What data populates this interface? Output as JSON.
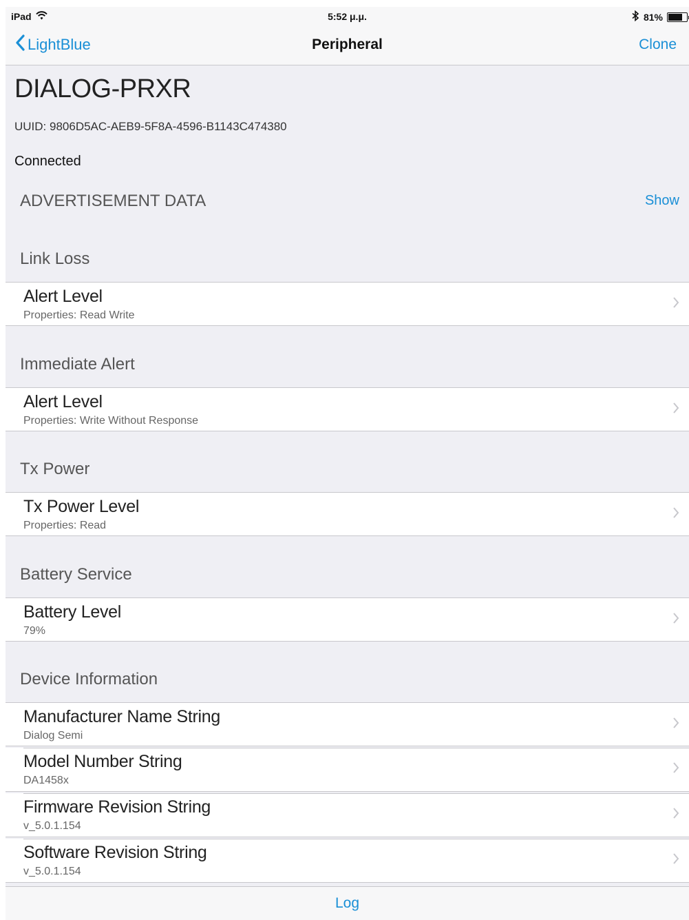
{
  "status_bar": {
    "device": "iPad",
    "time": "5:52 μ.μ.",
    "battery_text": "81%",
    "battery_level": 0.81
  },
  "nav": {
    "back_label": "LightBlue",
    "title": "Peripheral",
    "action_label": "Clone"
  },
  "peripheral": {
    "name": "DIALOG-PRXR",
    "uuid": "UUID: 9806D5AC-AEB9-5F8A-4596-B1143C474380",
    "state": "Connected"
  },
  "advertisement": {
    "title": "ADVERTISEMENT DATA",
    "show_label": "Show"
  },
  "services": [
    {
      "name": "Link Loss",
      "characteristics": [
        {
          "name": "Alert Level",
          "detail": "Properties: Read Write"
        }
      ]
    },
    {
      "name": "Immediate Alert",
      "characteristics": [
        {
          "name": "Alert Level",
          "detail": "Properties: Write Without Response"
        }
      ]
    },
    {
      "name": "Tx Power",
      "characteristics": [
        {
          "name": "Tx Power Level",
          "detail": "Properties: Read"
        }
      ]
    },
    {
      "name": "Battery Service",
      "characteristics": [
        {
          "name": "Battery Level",
          "detail": "79%"
        }
      ]
    },
    {
      "name": "Device Information",
      "characteristics": [
        {
          "name": "Manufacturer Name String",
          "detail": "Dialog Semi"
        },
        {
          "name": "Model Number String",
          "detail": "DA1458x"
        },
        {
          "name": "Firmware Revision String",
          "detail": "v_5.0.1.154"
        },
        {
          "name": "Software Revision String",
          "detail": "v_5.0.1.154"
        }
      ]
    }
  ],
  "toolbar": {
    "log_label": "Log"
  },
  "colors": {
    "accent": "#1a8fd6",
    "background": "#efeff4",
    "separator": "#c8c7cc"
  },
  "icons": {
    "back": "chevron-left-icon",
    "row": "chevron-right-icon",
    "wifi": "wifi-icon",
    "bluetooth": "bluetooth-icon",
    "battery": "battery-icon"
  }
}
